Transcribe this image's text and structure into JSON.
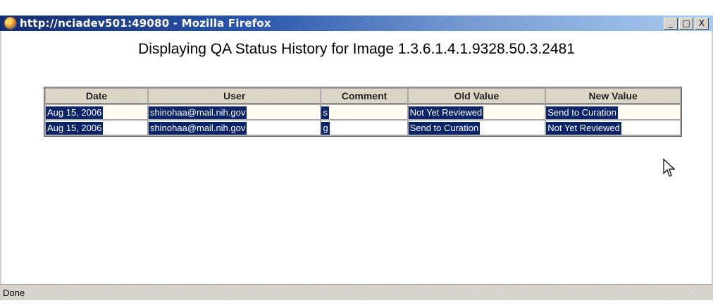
{
  "window": {
    "title": "http://nciadev501:49080 - Mozilla Firefox",
    "buttons": {
      "minimize": "_",
      "maximize": "□",
      "close": "X"
    }
  },
  "page": {
    "heading": "Displaying QA Status History for Image 1.3.6.1.4.1.9328.50.3.2481"
  },
  "table": {
    "headers": [
      "Date",
      "User",
      "Comment",
      "Old Value",
      "New Value"
    ],
    "rows": [
      [
        "Aug 15, 2006",
        "shinohaa@mail.nih.gov",
        "s",
        "Not Yet Reviewed",
        "Send to Curation"
      ],
      [
        "Aug 15, 2006",
        "shinohaa@mail.nih.gov",
        "g",
        "Send to Curation",
        "Not Yet Reviewed"
      ]
    ]
  },
  "status_bar": {
    "text": "Done"
  },
  "colors": {
    "selection": "#0a246a",
    "title_bar": "#0a246a",
    "header_bg": "#d8d2c0"
  }
}
